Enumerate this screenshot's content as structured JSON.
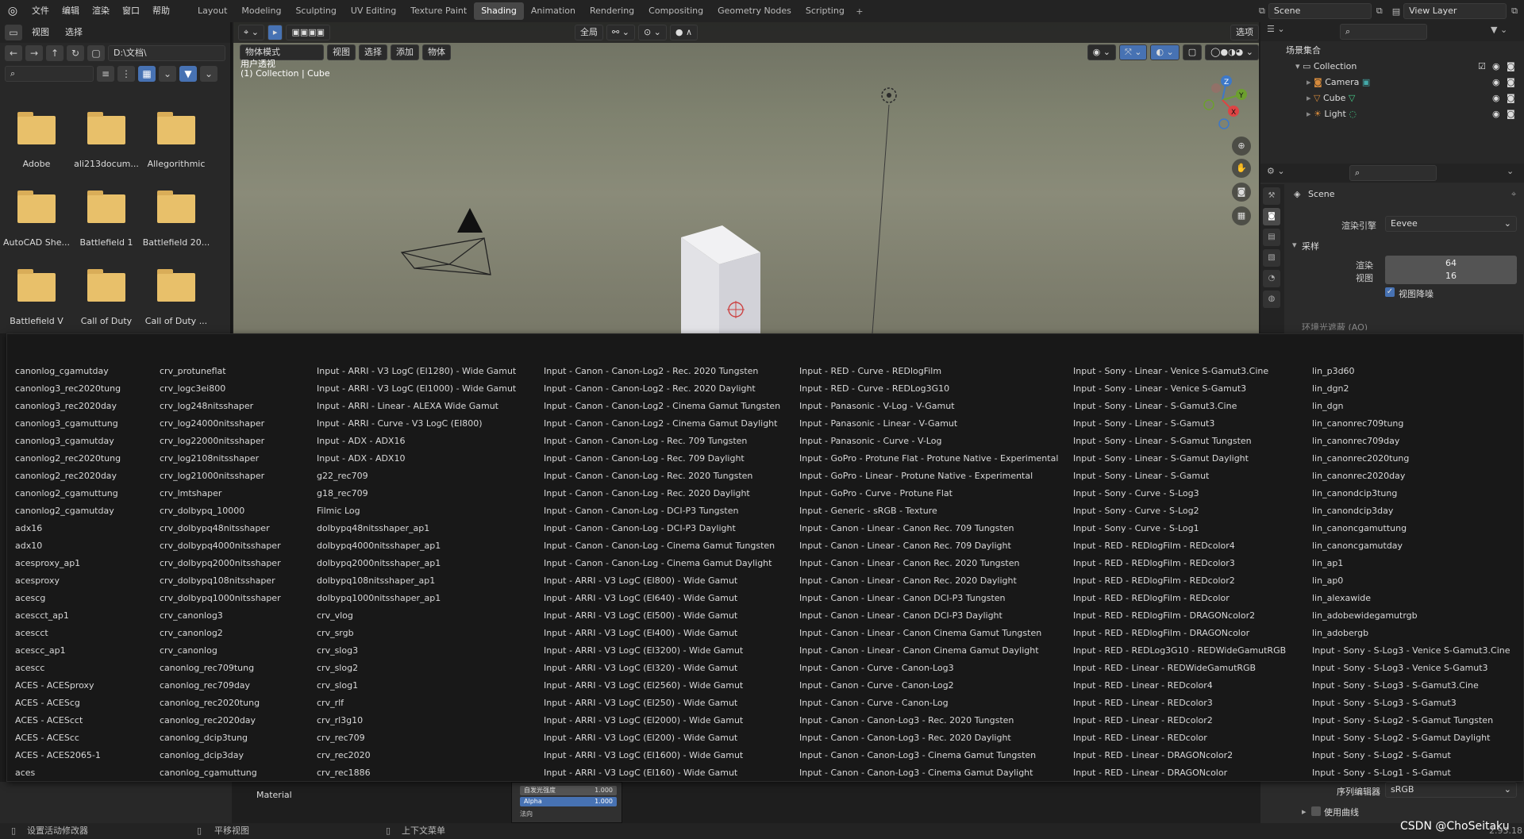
{
  "menubar": {
    "items": [
      "文件",
      "编辑",
      "渲染",
      "窗口",
      "帮助"
    ],
    "workspaces": [
      "Layout",
      "Modeling",
      "Sculpting",
      "UV Editing",
      "Texture Paint",
      "Shading",
      "Animation",
      "Rendering",
      "Compositing",
      "Geometry Nodes",
      "Scripting"
    ],
    "active_workspace": "Shading",
    "add": "+",
    "scene": "Scene",
    "view_layer": "View Layer"
  },
  "filebrowser": {
    "menus": [
      "视图",
      "选择"
    ],
    "path": "D:\\文档\\",
    "folders": [
      "Adobe",
      "ali213docum...",
      "Allegorithmic",
      "AutoCAD She...",
      "Battlefield 1",
      "Battlefield 20...",
      "Battlefield V",
      "Call of Duty",
      "Call of Duty ..."
    ]
  },
  "viewport": {
    "mode": "物体模式",
    "menus": [
      "视图",
      "选择",
      "添加",
      "物体"
    ],
    "transform": "全局",
    "options": "选项",
    "perspective": "用户透视",
    "collection_label": "(1) Collection | Cube",
    "gizmo": {
      "x": "X",
      "y": "Y",
      "z": "Z"
    }
  },
  "outliner": {
    "root": "场景集合",
    "collection": "Collection",
    "objects": [
      "Camera",
      "Cube",
      "Light"
    ]
  },
  "properties": {
    "scene_label": "Scene",
    "engine_label": "渲染引擎",
    "engine_value": "Eevee",
    "sampling": "采样",
    "render_label": "渲染",
    "render_value": "64",
    "viewport_label": "视图",
    "viewport_value": "16",
    "denoise": "视图降噪",
    "ao_partial": "环境光遮蔽 (AO)",
    "sequencer_label": "序列编辑器",
    "sequencer_value": "sRGB",
    "use_curves": "使用曲线"
  },
  "popup": {
    "columns": [
      [
        "canonlog_cgamutday",
        "canonlog3_rec2020tung",
        "canonlog3_rec2020day",
        "canonlog3_cgamuttung",
        "canonlog3_cgamutday",
        "canonlog2_rec2020tung",
        "canonlog2_rec2020day",
        "canonlog2_cgamuttung",
        "canonlog2_cgamutday",
        "adx16",
        "adx10",
        "acesproxy_ap1",
        "acesproxy",
        "acescg",
        "acescct_ap1",
        "acescct",
        "acescc_ap1",
        "acescc",
        "ACES - ACESproxy",
        "ACES - ACEScg",
        "ACES - ACEScct",
        "ACES - ACEScc",
        "ACES - ACES2065-1",
        "aces"
      ],
      [
        "crv_protuneflat",
        "crv_logc3ei800",
        "crv_log248nitsshaper",
        "crv_log24000nitsshaper",
        "crv_log22000nitsshaper",
        "crv_log2108nitsshaper",
        "crv_log21000nitsshaper",
        "crv_lmtshaper",
        "crv_dolbypq_10000",
        "crv_dolbypq48nitsshaper",
        "crv_dolbypq4000nitsshaper",
        "crv_dolbypq2000nitsshaper",
        "crv_dolbypq108nitsshaper",
        "crv_dolbypq1000nitsshaper",
        "crv_canonlog3",
        "crv_canonlog2",
        "crv_canonlog",
        "canonlog_rec709tung",
        "canonlog_rec709day",
        "canonlog_rec2020tung",
        "canonlog_rec2020day",
        "canonlog_dcip3tung",
        "canonlog_dcip3day",
        "canonlog_cgamuttung"
      ],
      [
        "Input - ARRI - V3 LogC (EI1280) - Wide Gamut",
        "Input - ARRI - V3 LogC (EI1000) - Wide Gamut",
        "Input - ARRI - Linear - ALEXA Wide Gamut",
        "Input - ARRI - Curve - V3 LogC (EI800)",
        "Input - ADX - ADX16",
        "Input - ADX - ADX10",
        "g22_rec709",
        "g18_rec709",
        "Filmic Log",
        "dolbypq48nitsshaper_ap1",
        "dolbypq4000nitsshaper_ap1",
        "dolbypq2000nitsshaper_ap1",
        "dolbypq108nitsshaper_ap1",
        "dolbypq1000nitsshaper_ap1",
        "crv_vlog",
        "crv_srgb",
        "crv_slog3",
        "crv_slog2",
        "crv_slog1",
        "crv_rlf",
        "crv_rl3g10",
        "crv_rec709",
        "crv_rec2020",
        "crv_rec1886"
      ],
      [
        "Input - Canon - Canon-Log2 - Rec. 2020 Tungsten",
        "Input - Canon - Canon-Log2 - Rec. 2020 Daylight",
        "Input - Canon - Canon-Log2 - Cinema Gamut Tungsten",
        "Input - Canon - Canon-Log2 - Cinema Gamut Daylight",
        "Input - Canon - Canon-Log - Rec. 709 Tungsten",
        "Input - Canon - Canon-Log - Rec. 709 Daylight",
        "Input - Canon - Canon-Log - Rec. 2020 Tungsten",
        "Input - Canon - Canon-Log - Rec. 2020 Daylight",
        "Input - Canon - Canon-Log - DCI-P3 Tungsten",
        "Input - Canon - Canon-Log - DCI-P3 Daylight",
        "Input - Canon - Canon-Log - Cinema Gamut Tungsten",
        "Input - Canon - Canon-Log - Cinema Gamut Daylight",
        "Input - ARRI - V3 LogC (EI800) - Wide Gamut",
        "Input - ARRI - V3 LogC (EI640) - Wide Gamut",
        "Input - ARRI - V3 LogC (EI500) - Wide Gamut",
        "Input - ARRI - V3 LogC (EI400) - Wide Gamut",
        "Input - ARRI - V3 LogC (EI3200) - Wide Gamut",
        "Input - ARRI - V3 LogC (EI320) - Wide Gamut",
        "Input - ARRI - V3 LogC (EI2560) - Wide Gamut",
        "Input - ARRI - V3 LogC (EI250) - Wide Gamut",
        "Input - ARRI - V3 LogC (EI2000) - Wide Gamut",
        "Input - ARRI - V3 LogC (EI200) - Wide Gamut",
        "Input - ARRI - V3 LogC (EI1600) - Wide Gamut",
        "Input - ARRI - V3 LogC (EI160) - Wide Gamut"
      ],
      [
        "Input - RED - Curve - REDlogFilm",
        "Input - RED - Curve - REDLog3G10",
        "Input - Panasonic - V-Log - V-Gamut",
        "Input - Panasonic - Linear - V-Gamut",
        "Input - Panasonic - Curve - V-Log",
        "Input - GoPro - Protune Flat - Protune Native - Experimental",
        "Input - GoPro - Linear - Protune Native - Experimental",
        "Input - GoPro - Curve - Protune Flat",
        "Input - Generic - sRGB - Texture",
        "Input - Canon - Linear - Canon Rec. 709 Tungsten",
        "Input - Canon - Linear - Canon Rec. 709 Daylight",
        "Input - Canon - Linear - Canon Rec. 2020 Tungsten",
        "Input - Canon - Linear - Canon Rec. 2020 Daylight",
        "Input - Canon - Linear - Canon DCI-P3 Tungsten",
        "Input - Canon - Linear - Canon DCI-P3 Daylight",
        "Input - Canon - Linear - Canon Cinema Gamut Tungsten",
        "Input - Canon - Linear - Canon Cinema Gamut Daylight",
        "Input - Canon - Curve - Canon-Log3",
        "Input - Canon - Curve - Canon-Log2",
        "Input - Canon - Curve - Canon-Log",
        "Input - Canon - Canon-Log3 - Rec. 2020 Tungsten",
        "Input - Canon - Canon-Log3 - Rec. 2020 Daylight",
        "Input - Canon - Canon-Log3 - Cinema Gamut Tungsten",
        "Input - Canon - Canon-Log3 - Cinema Gamut Daylight"
      ],
      [
        "Input - Sony - Linear - Venice S-Gamut3.Cine",
        "Input - Sony - Linear - Venice S-Gamut3",
        "Input - Sony - Linear - S-Gamut3.Cine",
        "Input - Sony - Linear - S-Gamut3",
        "Input - Sony - Linear - S-Gamut Tungsten",
        "Input - Sony - Linear - S-Gamut Daylight",
        "Input - Sony - Linear - S-Gamut",
        "Input - Sony - Curve - S-Log3",
        "Input - Sony - Curve - S-Log2",
        "Input - Sony - Curve - S-Log1",
        "Input - RED - REDlogFilm - REDcolor4",
        "Input - RED - REDlogFilm - REDcolor3",
        "Input - RED - REDlogFilm - REDcolor2",
        "Input - RED - REDlogFilm - REDcolor",
        "Input - RED - REDlogFilm - DRAGONcolor2",
        "Input - RED - REDlogFilm - DRAGONcolor",
        "Input - RED - REDLog3G10 - REDWideGamutRGB",
        "Input - RED - Linear - REDWideGamutRGB",
        "Input - RED - Linear - REDcolor4",
        "Input - RED - Linear - REDcolor3",
        "Input - RED - Linear - REDcolor2",
        "Input - RED - Linear - REDcolor",
        "Input - RED - Linear - DRAGONcolor2",
        "Input - RED - Linear - DRAGONcolor"
      ],
      [
        "lin_p3d60",
        "lin_dgn2",
        "lin_dgn",
        "lin_canonrec709tung",
        "lin_canonrec709day",
        "lin_canonrec2020tung",
        "lin_canonrec2020day",
        "lin_canondcip3tung",
        "lin_canondcip3day",
        "lin_canoncgamuttung",
        "lin_canoncgamutday",
        "lin_ap1",
        "lin_ap0",
        "lin_alexawide",
        "lin_adobewidegamutrgb",
        "lin_adobergb",
        "Input - Sony - S-Log3 - Venice S-Gamut3.Cine",
        "Input - Sony - S-Log3 - Venice S-Gamut3",
        "Input - Sony - S-Log3 - S-Gamut3.Cine",
        "Input - Sony - S-Log3 - S-Gamut3",
        "Input - Sony - S-Log2 - S-Gamut Tungsten",
        "Input - Sony - S-Log2 - S-Gamut Daylight",
        "Input - Sony - S-Log2 - S-Gamut",
        "Input - Sony - S-Log1 - S-Gamut"
      ]
    ]
  },
  "node_editor": {
    "material": "Material",
    "emission_strength_label": "自发光强度",
    "emission_strength_value": "1.000",
    "alpha_label": "Alpha",
    "alpha_value": "1.000",
    "normal_label": "法向"
  },
  "statusbar": {
    "left": "设置活动修改器",
    "middle": "平移视图",
    "right": "上下文菜单",
    "version": "2.93.18",
    "watermark": "CSDN @ChoSeitaku"
  },
  "colors": {
    "accent": "#4772b3",
    "folder": "#e8c06a"
  }
}
